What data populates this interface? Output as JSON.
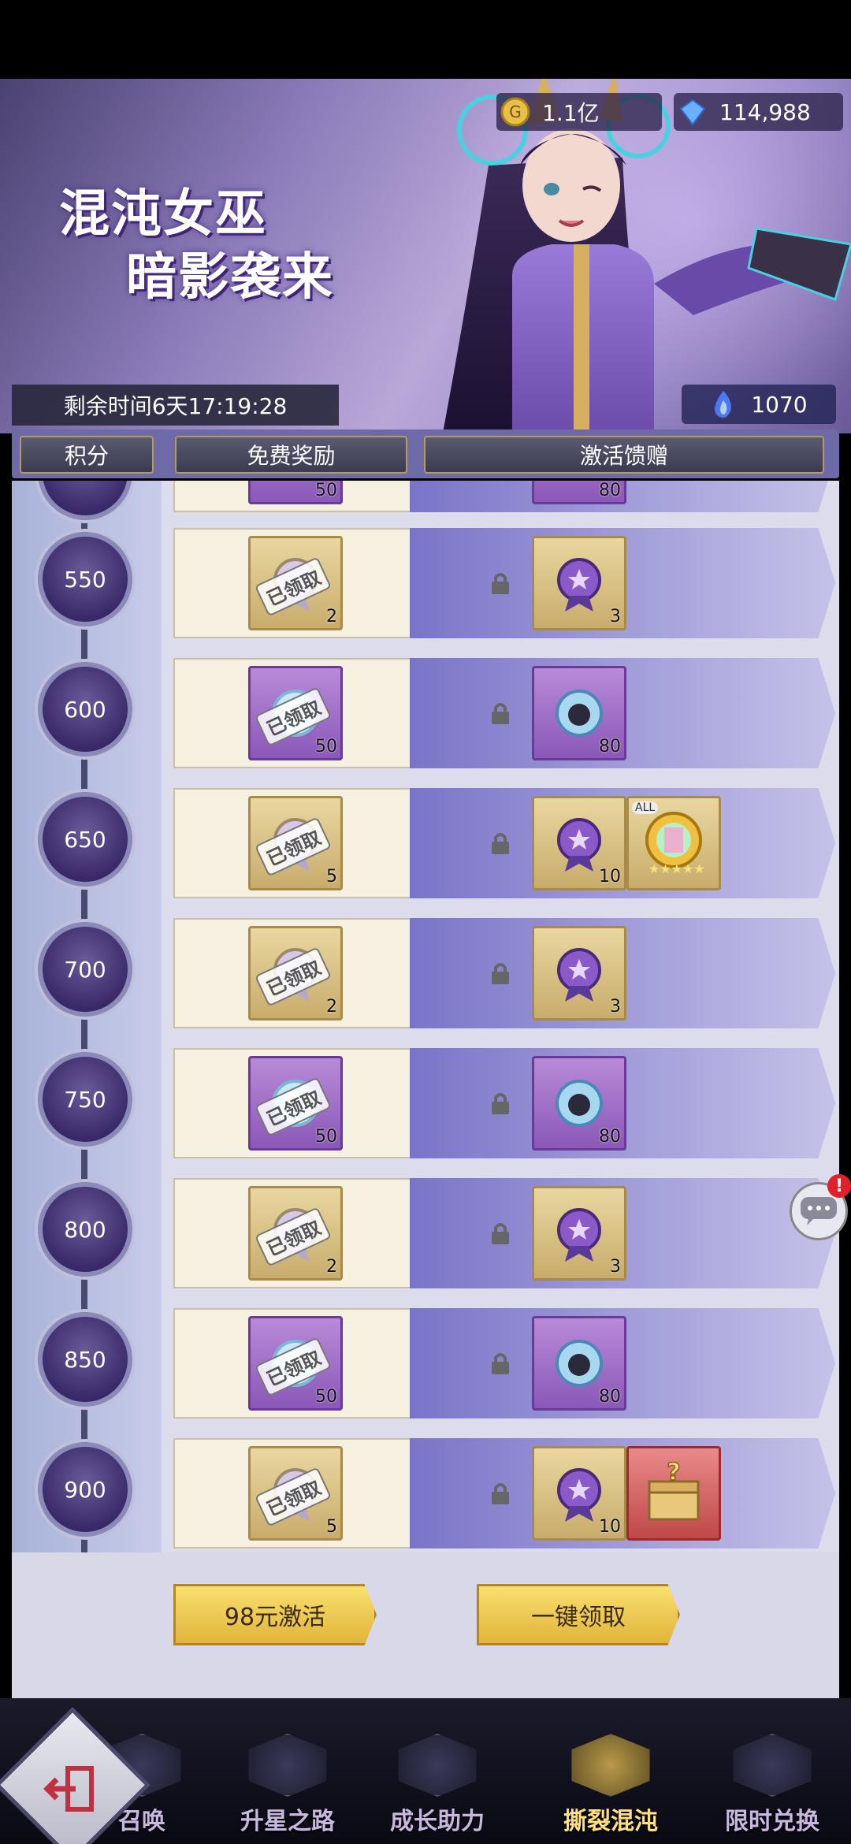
{
  "header": {
    "title_line1": "混沌女巫",
    "title_line2": "暗影袭来",
    "gold": "1.1亿",
    "gems": "114,988",
    "remaining_time": "剩余时间6天17:19:28",
    "points": "1070"
  },
  "tabs": [
    {
      "label": "积分"
    },
    {
      "label": "免费奖励"
    },
    {
      "label": "激活馈赠"
    }
  ],
  "claimed_label": "已领取",
  "rows": [
    {
      "score": "550",
      "free_qty": "2",
      "paid1_qty": "3"
    },
    {
      "score": "600",
      "free_qty": "50",
      "paid1_qty": "80"
    },
    {
      "score": "650",
      "free_qty": "5",
      "paid1_qty": "10",
      "paid2_tag": "ALL"
    },
    {
      "score": "700",
      "free_qty": "2",
      "paid1_qty": "3"
    },
    {
      "score": "750",
      "free_qty": "50",
      "paid1_qty": "80"
    },
    {
      "score": "800",
      "free_qty": "2",
      "paid1_qty": "3"
    },
    {
      "score": "850",
      "free_qty": "50",
      "paid1_qty": "80"
    },
    {
      "score": "900",
      "free_qty": "5",
      "paid1_qty": "10"
    }
  ],
  "partial_row": {
    "free_qty": "50",
    "paid1_qty": "80"
  },
  "buttons": {
    "activate": "98元激活",
    "claim_all": "一键领取"
  },
  "chat_badge": "!",
  "nav": [
    {
      "label": "召唤"
    },
    {
      "label": "升星之路"
    },
    {
      "label": "成长助力"
    },
    {
      "label": "撕裂混沌"
    },
    {
      "label": "限时兑换"
    }
  ],
  "colors": {
    "accent_gold": "#e2b43a",
    "paid_purple": "#7a74c8",
    "nav_active": "#ffe080"
  }
}
